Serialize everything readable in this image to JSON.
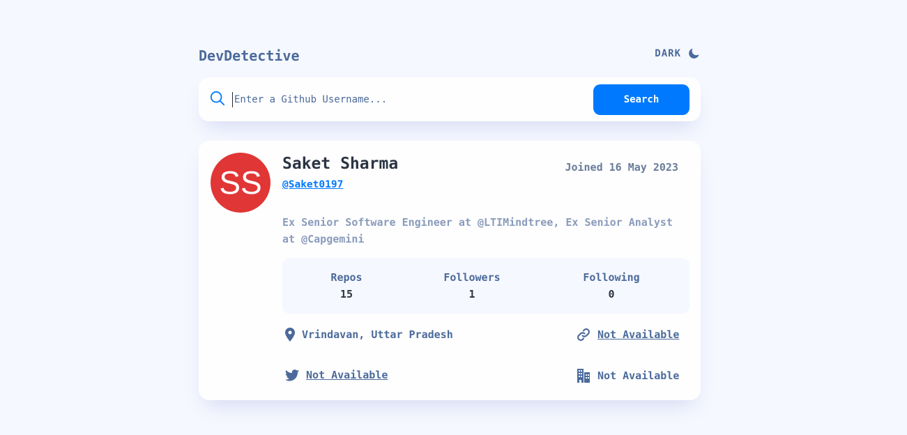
{
  "header": {
    "brand": "DevDetective",
    "mode_label": "DARK"
  },
  "search": {
    "placeholder": "Enter a Github Username...",
    "value": "",
    "button_label": "Search"
  },
  "profile": {
    "avatar_initials": "SS",
    "avatar_color": "#e13636",
    "name": "Saket Sharma",
    "login": "@Saket0197",
    "joined": "Joined 16 May 2023",
    "bio": "Ex Senior Software Engineer at @LTIMindtree, Ex Senior Analyst at @Capgemini",
    "stats": [
      {
        "label": "Repos",
        "value": "15"
      },
      {
        "label": "Followers",
        "value": "1"
      },
      {
        "label": "Following",
        "value": "0"
      }
    ],
    "location": "Vrindavan, Uttar Pradesh",
    "website": "Not Available",
    "twitter": "Not Available",
    "company": "Not Available"
  },
  "colors": {
    "accent": "#0079ff",
    "background": "#f6f8ff",
    "text_primary": "#2b3442",
    "text_secondary": "#4b6a9b"
  }
}
